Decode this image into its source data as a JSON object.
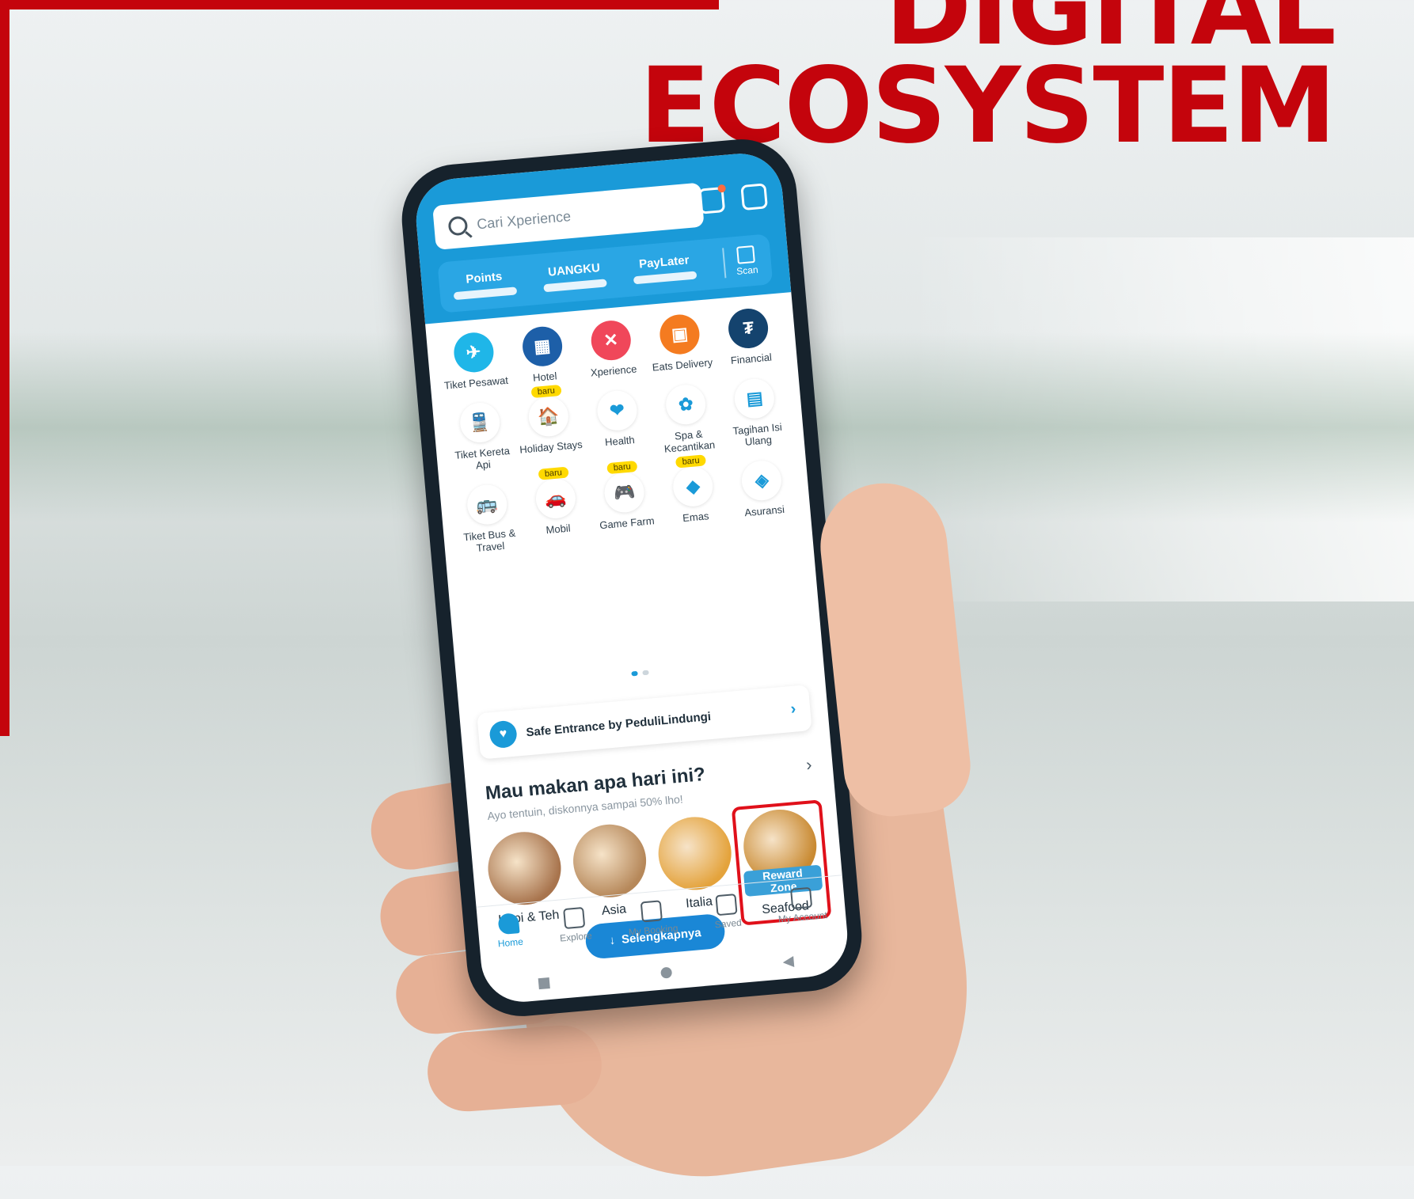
{
  "headline": {
    "line1": "DIGITAL",
    "line2": "ECOSYSTEM"
  },
  "colors": {
    "brand_red": "#c4040c",
    "app_blue": "#1a9ad8",
    "badge_yellow": "#ffd900"
  },
  "app": {
    "search_placeholder": "Cari Xperience",
    "top_icons": [
      "bell-icon",
      "chat-icon"
    ],
    "wallet": [
      {
        "label": "Points",
        "icon": "points-icon"
      },
      {
        "label": "UANGKU",
        "icon": "wallet-icon"
      },
      {
        "label": "PayLater",
        "icon": "paylater-icon"
      }
    ],
    "scan_label": "Scan",
    "services": [
      {
        "label": "Tiket Pesawat",
        "color": "#1fb6e8",
        "glyph": "✈",
        "badge": ""
      },
      {
        "label": "Hotel",
        "color": "#1d5fa8",
        "glyph": "▦",
        "badge": ""
      },
      {
        "label": "Xperience",
        "color": "#f0475a",
        "glyph": "✕",
        "badge": ""
      },
      {
        "label": "Eats Delivery",
        "color": "#f47b20",
        "glyph": "▣",
        "badge": ""
      },
      {
        "label": "Financial",
        "color": "#14436e",
        "glyph": "₮",
        "badge": ""
      },
      {
        "label": "Tiket Kereta Api",
        "color": "#ffffff",
        "glyph": "🚆",
        "badge": ""
      },
      {
        "label": "Holiday Stays",
        "color": "#ffffff",
        "glyph": "🏠",
        "badge": "baru"
      },
      {
        "label": "Health",
        "color": "#ffffff",
        "glyph": "❤",
        "badge": ""
      },
      {
        "label": "Spa & Kecantikan",
        "color": "#ffffff",
        "glyph": "✿",
        "badge": ""
      },
      {
        "label": "Tagihan Isi Ulang",
        "color": "#ffffff",
        "glyph": "▤",
        "badge": ""
      },
      {
        "label": "Tiket Bus & Travel",
        "color": "#ffffff",
        "glyph": "🚌",
        "badge": ""
      },
      {
        "label": "Mobil",
        "color": "#ffffff",
        "glyph": "🚗",
        "badge": "baru"
      },
      {
        "label": "Game Farm",
        "color": "#ffffff",
        "glyph": "🎮",
        "badge": "baru"
      },
      {
        "label": "Emas",
        "color": "#ffffff",
        "glyph": "◆",
        "badge": "baru"
      },
      {
        "label": "Asuransi",
        "color": "#ffffff",
        "glyph": "◈",
        "badge": ""
      }
    ],
    "safe_entrance": "Safe Entrance by PeduliLindungi",
    "food_section": {
      "title": "Mau makan apa hari ini?",
      "subtitle": "Ayo tentuin, diskonnya sampai 50% lho!",
      "items": [
        {
          "label": "Kopi & Teh",
          "color": "#a8744d",
          "extra": ""
        },
        {
          "label": "Asia",
          "color": "#b6885a",
          "extra": ""
        },
        {
          "label": "Italia",
          "color": "#e4a33c",
          "extra": ""
        },
        {
          "label": "Seafood",
          "color": "#c98a32",
          "extra": "Reward Zone"
        }
      ]
    },
    "more_button": "Selengkapnya",
    "nav": [
      {
        "label": "Home",
        "icon": "home-icon"
      },
      {
        "label": "Explore",
        "icon": "explore-icon"
      },
      {
        "label": "My Booking",
        "icon": "booking-icon"
      },
      {
        "label": "Saved",
        "icon": "saved-icon"
      },
      {
        "label": "My Account",
        "icon": "account-icon"
      }
    ]
  }
}
